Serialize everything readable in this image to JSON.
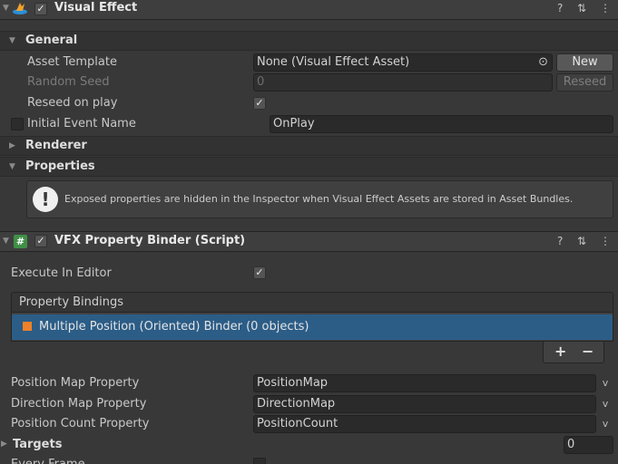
{
  "visual_effect": {
    "title": "Visual Effect",
    "enabled_check": "✓",
    "general": {
      "title": "General",
      "asset_template": {
        "label": "Asset Template",
        "value": "None (Visual Effect Asset)",
        "button": "New"
      },
      "random_seed": {
        "label": "Random Seed",
        "value": "0",
        "button": "Reseed"
      },
      "reseed_on_play": {
        "label": "Reseed on play",
        "checked": "✓"
      },
      "initial_event_name": {
        "label": "Initial Event Name",
        "value": "OnPlay"
      }
    },
    "renderer": {
      "title": "Renderer"
    },
    "properties": {
      "title": "Properties",
      "help": "Exposed properties are hidden in the Inspector when Visual Effect Assets are stored in Asset Bundles."
    }
  },
  "vfx_binder": {
    "title": "VFX Property Binder (Script)",
    "enabled_check": "✓",
    "execute_in_editor": {
      "label": "Execute In Editor",
      "checked": "✓"
    },
    "property_bindings": {
      "title": "Property Bindings",
      "items": [
        {
          "label": "Multiple Position (Oriented) Binder (0 objects)",
          "color": "#f0812a",
          "selected": true
        }
      ],
      "add": "+",
      "remove": "−"
    },
    "fields": [
      {
        "label": "Position Map Property",
        "value": "PositionMap"
      },
      {
        "label": "Direction Map Property",
        "value": "DirectionMap"
      },
      {
        "label": "Position Count Property",
        "value": "PositionCount"
      }
    ],
    "targets": {
      "label": "Targets",
      "count": "0"
    },
    "every_frame": {
      "label": "Every Frame"
    }
  },
  "header_icons": {
    "help": "?",
    "presets": "⇅",
    "menu": "⋮",
    "target": "⊙",
    "dropdown": "v",
    "warning": "!"
  },
  "colors": {
    "selection": "#2c5d87",
    "accent_orange": "#f0812a",
    "background": "#383838"
  }
}
